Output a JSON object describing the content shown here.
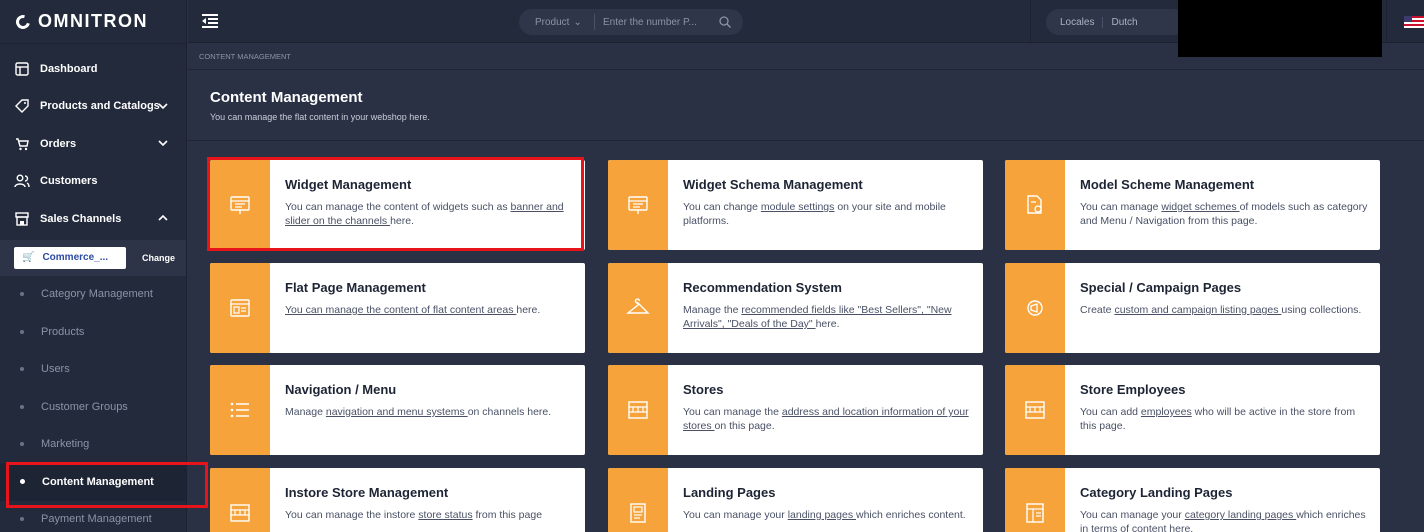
{
  "brand": "OMNITRON",
  "sidebar": {
    "nav": [
      {
        "label": "Dashboard",
        "icon": "layout-icon",
        "chevron": ""
      },
      {
        "label": "Products and Catalogs",
        "icon": "tag-icon",
        "chevron": "down"
      },
      {
        "label": "Orders",
        "icon": "cart-icon",
        "chevron": "down"
      },
      {
        "label": "Customers",
        "icon": "users-icon",
        "chevron": ""
      },
      {
        "label": "Sales Channels",
        "icon": "store-icon",
        "chevron": "up"
      }
    ],
    "channel": {
      "name": "Commerce_...",
      "change_label": "Change"
    },
    "sub_items": [
      {
        "label": "Category Management",
        "active": false
      },
      {
        "label": "Products",
        "active": false
      },
      {
        "label": "Users",
        "active": false
      },
      {
        "label": "Customer Groups",
        "active": false
      },
      {
        "label": "Marketing",
        "active": false
      },
      {
        "label": "Content Management",
        "active": true
      },
      {
        "label": "Payment Management",
        "active": false
      }
    ]
  },
  "topbar": {
    "search_type": "Product",
    "search_placeholder": "Enter the number P...",
    "locales_label": "Locales",
    "locale_value": "Dutch"
  },
  "breadcrumb": "CONTENT MANAGEMENT",
  "page": {
    "title": "Content Management",
    "subtitle": "You can manage the flat content in your webshop here."
  },
  "cards": [
    {
      "title": "Widget Management",
      "icon": "widget-icon",
      "desc": [
        {
          "t": "You can manage the content of widgets such as "
        },
        {
          "t": "banner and slider on the channels ",
          "u": true
        },
        {
          "t": "here."
        }
      ]
    },
    {
      "title": "Widget Schema Management",
      "icon": "monitor-icon",
      "desc": [
        {
          "t": "You can change "
        },
        {
          "t": "module settings",
          "u": true
        },
        {
          "t": " on your site and mobile platforms."
        }
      ]
    },
    {
      "title": "Model Scheme Management",
      "icon": "document-gear-icon",
      "desc": [
        {
          "t": "You can manage "
        },
        {
          "t": "widget schemes ",
          "u": true
        },
        {
          "t": "of models such as category and Menu / Navigation from this page."
        }
      ]
    },
    {
      "title": "Flat Page Management",
      "icon": "page-layout-icon",
      "desc": [
        {
          "t": "You can manage the content of flat content areas ",
          "u": true
        },
        {
          "t": "here."
        }
      ]
    },
    {
      "title": "Recommendation System",
      "icon": "hanger-icon",
      "desc": [
        {
          "t": "Manage the "
        },
        {
          "t": "recommended fields like \"Best Sellers\", \"New Arrivals\", \"Deals of the Day\" ",
          "u": true
        },
        {
          "t": "here."
        }
      ]
    },
    {
      "title": "Special / Campaign Pages",
      "icon": "campaign-icon",
      "desc": [
        {
          "t": "Create "
        },
        {
          "t": "custom and campaign listing pages ",
          "u": true
        },
        {
          "t": "using collections."
        }
      ]
    },
    {
      "title": "Navigation / Menu",
      "icon": "list-icon",
      "desc": [
        {
          "t": "Manage "
        },
        {
          "t": "navigation and menu systems ",
          "u": true
        },
        {
          "t": "on channels here."
        }
      ]
    },
    {
      "title": "Stores",
      "icon": "storefront-icon",
      "desc": [
        {
          "t": "You can manage the "
        },
        {
          "t": "address and location information of your stores ",
          "u": true
        },
        {
          "t": "on this page."
        }
      ]
    },
    {
      "title": "Store Employees",
      "icon": "storefront-icon",
      "desc": [
        {
          "t": "You can add "
        },
        {
          "t": "employees",
          "u": true
        },
        {
          "t": " who will be active in the store from this page."
        }
      ]
    },
    {
      "title": "Instore Store Management",
      "icon": "storefront-icon",
      "desc": [
        {
          "t": "You can manage the instore "
        },
        {
          "t": "store status",
          "u": true
        },
        {
          "t": " from this page"
        }
      ]
    },
    {
      "title": "Landing Pages",
      "icon": "landing-icon",
      "desc": [
        {
          "t": "You can manage your "
        },
        {
          "t": "landing pages ",
          "u": true
        },
        {
          "t": "which enriches content."
        }
      ]
    },
    {
      "title": "Category Landing Pages",
      "icon": "category-page-icon",
      "desc": [
        {
          "t": "You can manage your "
        },
        {
          "t": "category landing pages ",
          "u": true
        },
        {
          "t": "which enriches in terms of content here."
        }
      ]
    }
  ],
  "colors": {
    "accent": "#f7a33c",
    "highlight": "#e8141b",
    "background": "#2a3144",
    "sidebar": "#232a3b"
  }
}
